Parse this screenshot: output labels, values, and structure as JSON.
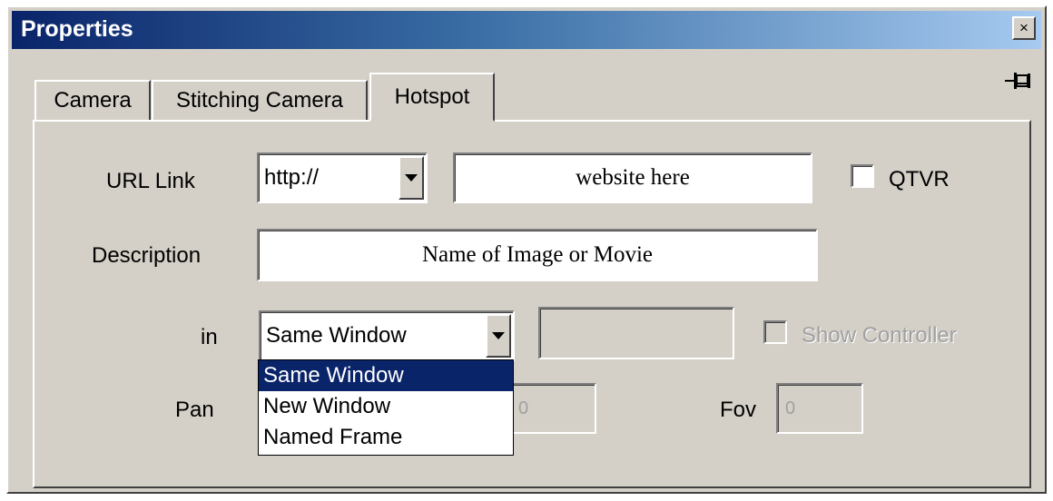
{
  "window": {
    "title": "Properties",
    "close_label": "×"
  },
  "tabs": [
    {
      "label": "Camera",
      "active": false
    },
    {
      "label": "Stitching Camera",
      "active": false
    },
    {
      "label": "Hotspot",
      "active": true
    }
  ],
  "form": {
    "url_link": {
      "label": "URL Link",
      "protocol": "http://",
      "value": "website here",
      "qtvr_label": "QTVR",
      "qtvr_checked": false
    },
    "description": {
      "label": "Description",
      "value": "Name of Image or Movie"
    },
    "target": {
      "label": "in",
      "selected": "Same Window",
      "options": [
        "Same Window",
        "New Window",
        "Named Frame"
      ],
      "frame_name": "",
      "show_controller_label": "Show Controller",
      "show_controller_checked": false
    },
    "pan": {
      "label": "Pan",
      "value": "0"
    },
    "fov": {
      "label": "Fov",
      "value": "0"
    }
  },
  "colors": {
    "face": "#d4d0c8",
    "title_start": "#0a246a",
    "title_end": "#a6caf0",
    "highlight": "#0a246a"
  }
}
